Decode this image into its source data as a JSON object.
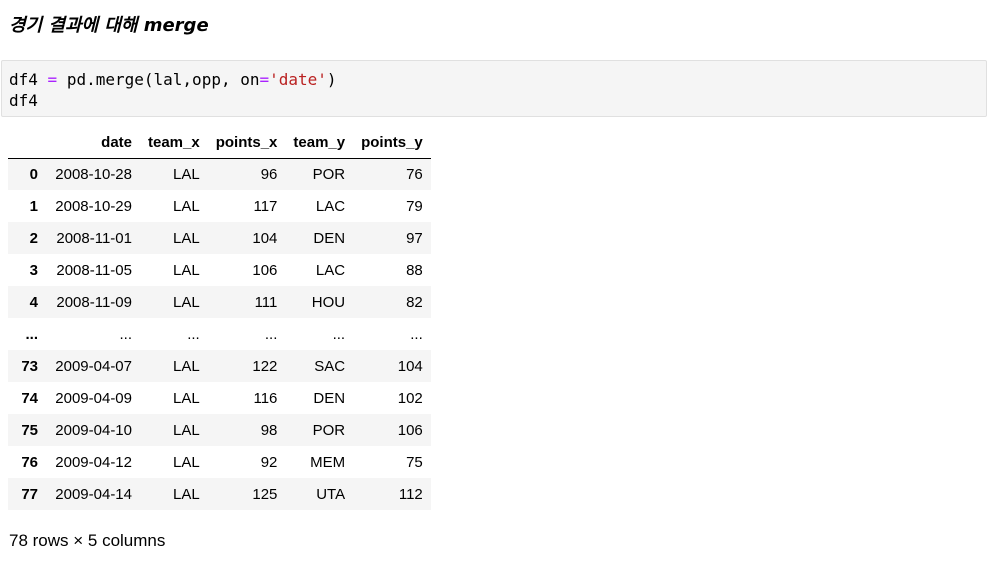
{
  "heading": "경기 결과에 대해 merge",
  "code": {
    "line1": {
      "var": "df4",
      "eq": "=",
      "call": "pd.merge(lal,opp, on",
      "eq2": "=",
      "str": "'date'",
      "close": ")"
    },
    "line2": "df4"
  },
  "table": {
    "columns": [
      "",
      "date",
      "team_x",
      "points_x",
      "team_y",
      "points_y"
    ],
    "rows": [
      [
        "0",
        "2008-10-28",
        "LAL",
        "96",
        "POR",
        "76"
      ],
      [
        "1",
        "2008-10-29",
        "LAL",
        "117",
        "LAC",
        "79"
      ],
      [
        "2",
        "2008-11-01",
        "LAL",
        "104",
        "DEN",
        "97"
      ],
      [
        "3",
        "2008-11-05",
        "LAL",
        "106",
        "LAC",
        "88"
      ],
      [
        "4",
        "2008-11-09",
        "LAL",
        "111",
        "HOU",
        "82"
      ],
      [
        "...",
        "...",
        "...",
        "...",
        "...",
        "..."
      ],
      [
        "73",
        "2009-04-07",
        "LAL",
        "122",
        "SAC",
        "104"
      ],
      [
        "74",
        "2009-04-09",
        "LAL",
        "116",
        "DEN",
        "102"
      ],
      [
        "75",
        "2009-04-10",
        "LAL",
        "98",
        "POR",
        "106"
      ],
      [
        "76",
        "2009-04-12",
        "LAL",
        "92",
        "MEM",
        "75"
      ],
      [
        "77",
        "2009-04-14",
        "LAL",
        "125",
        "UTA",
        "112"
      ]
    ]
  },
  "summary": "78 rows × 5 columns"
}
